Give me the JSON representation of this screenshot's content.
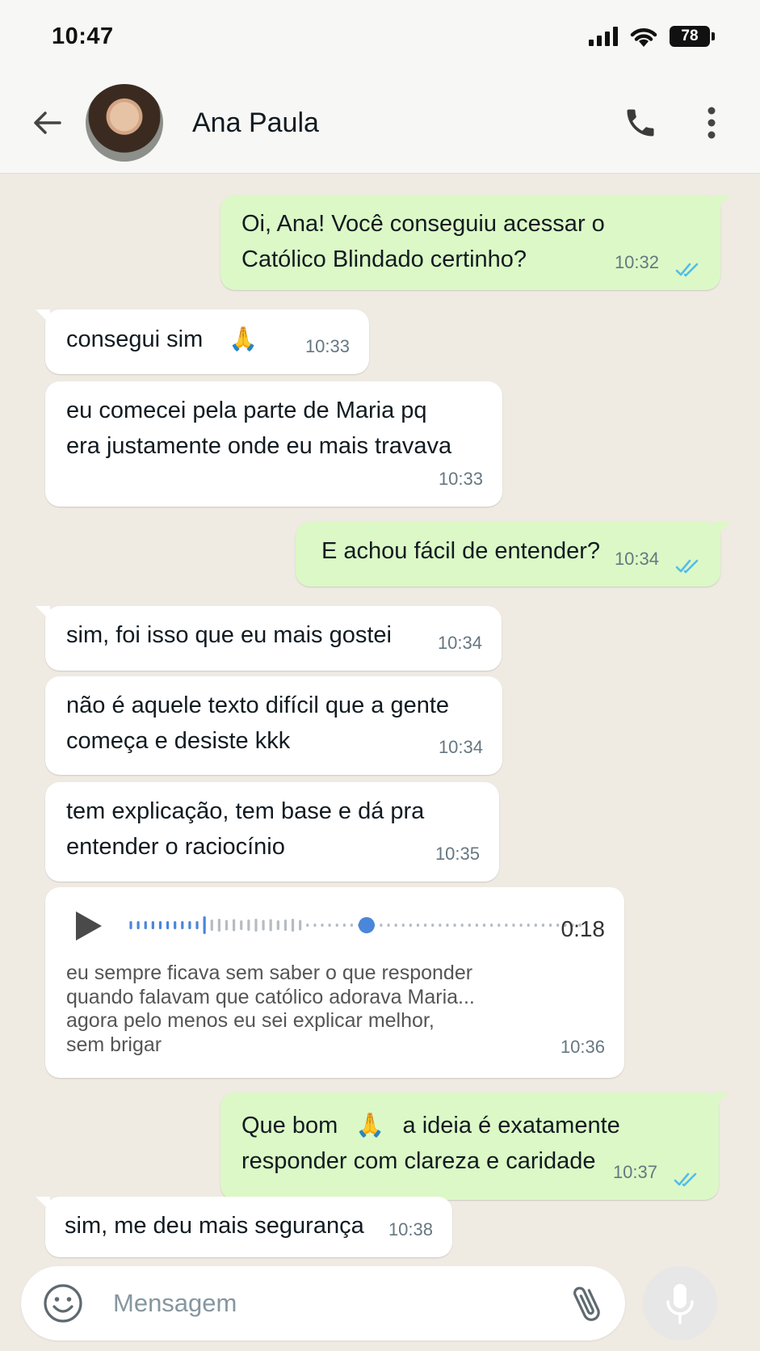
{
  "status_bar": {
    "time": "10:47",
    "battery": "78"
  },
  "header": {
    "contact_name": "Ana Paula"
  },
  "messages": [
    {
      "direction": "out",
      "lines": [
        "Oi, Ana! Você conseguiu acessar o",
        "Católico Blindado certinho?"
      ],
      "time": "10:32",
      "read": true
    },
    {
      "direction": "in",
      "text": "consegui sim",
      "emoji": "🙏",
      "time": "10:33"
    },
    {
      "direction": "in",
      "lines": [
        "eu comecei pela parte de Maria pq",
        "era justamente onde eu mais travava"
      ],
      "time": "10:33"
    },
    {
      "direction": "out",
      "text": "E achou fácil de entender?",
      "time": "10:34",
      "read": true
    },
    {
      "direction": "in",
      "text": "sim, foi isso que eu mais gostei",
      "time": "10:34"
    },
    {
      "direction": "in",
      "lines": [
        "não é aquele texto difícil que a gente",
        "começa e desiste kkk"
      ],
      "time": "10:34"
    },
    {
      "direction": "in",
      "lines": [
        "tem explicação, tem base e dá pra",
        "entender o raciocínio"
      ],
      "time": "10:35"
    },
    {
      "direction": "in",
      "type": "voice",
      "duration": "0:18",
      "progress": 0.64,
      "transcript": [
        "eu sempre ficava sem saber o que responder",
        "quando falavam que católico adorava Maria...",
        "agora pelo menos eu sei explicar melhor,",
        "sem brigar"
      ],
      "time": "10:36"
    },
    {
      "direction": "out",
      "text_before": "Que bom",
      "emoji": "🙏",
      "text_after": "a ideia é exatamente",
      "line2": "responder com clareza e caridade",
      "time": "10:37",
      "read": true
    },
    {
      "direction": "in",
      "text": "sim, me deu mais segurança",
      "time": "10:38"
    }
  ],
  "composer": {
    "placeholder": "Mensagem"
  },
  "colors": {
    "incoming": "#ffffff",
    "outgoing": "#dcf8c6",
    "read_ticks": "#53bdeb",
    "background": "#efeae2"
  }
}
